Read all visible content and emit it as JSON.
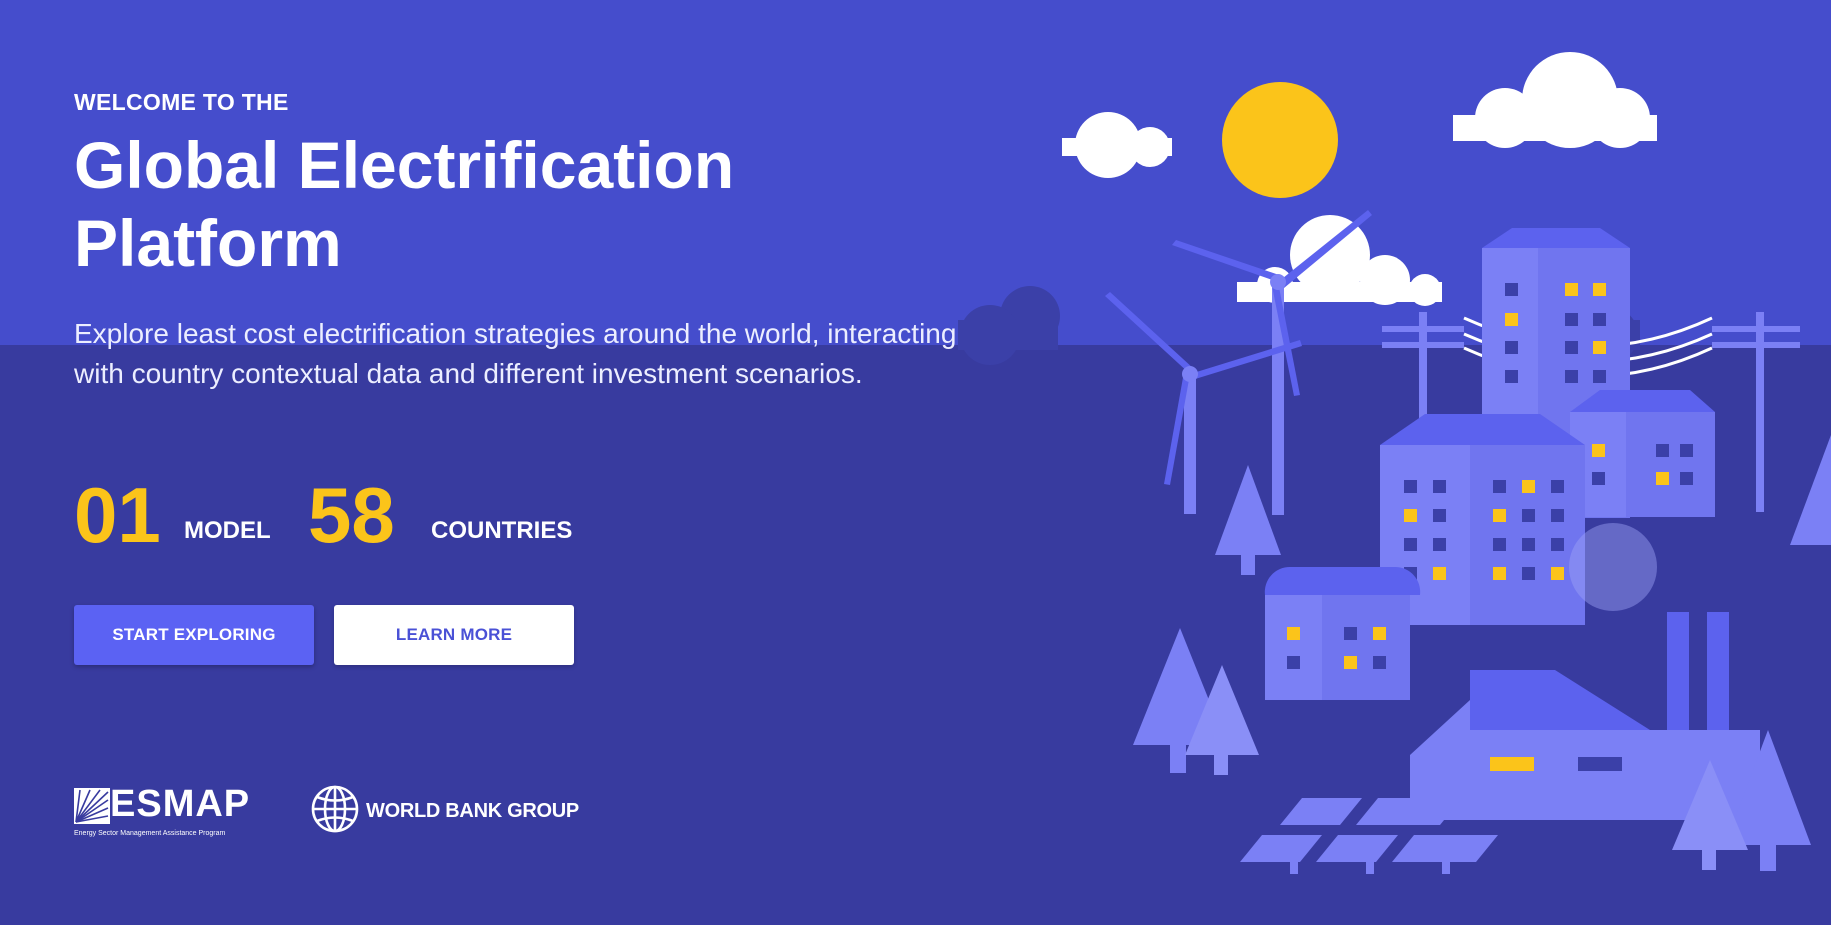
{
  "hero": {
    "eyebrow": "WELCOME TO THE",
    "title_line1": "Global Electrification",
    "title_line2": "Platform",
    "description": "Explore least cost electrification strategies around the world, interacting with country contextual data and different investment scenarios."
  },
  "stats": [
    {
      "value": "01",
      "label": "MODEL"
    },
    {
      "value": "58",
      "label": "COUNTRIES"
    }
  ],
  "buttons": {
    "primary": "START EXPLORING",
    "secondary": "LEARN MORE"
  },
  "logos": {
    "esmap_word": "ESMAP",
    "esmap_subtitle": "Energy Sector Management Assistance Program",
    "wbg_text": "WORLD BANK GROUP"
  },
  "colors": {
    "sky": "#454dcc",
    "ground": "#383b9f",
    "accent_yellow": "#fbc41a",
    "primary_button": "#5b62f3",
    "building": "#7b80f5",
    "building_dark": "#5c62ee"
  },
  "icons": {
    "globe": "globe-icon",
    "esmap_logo": "esmap-sunburst-icon"
  }
}
